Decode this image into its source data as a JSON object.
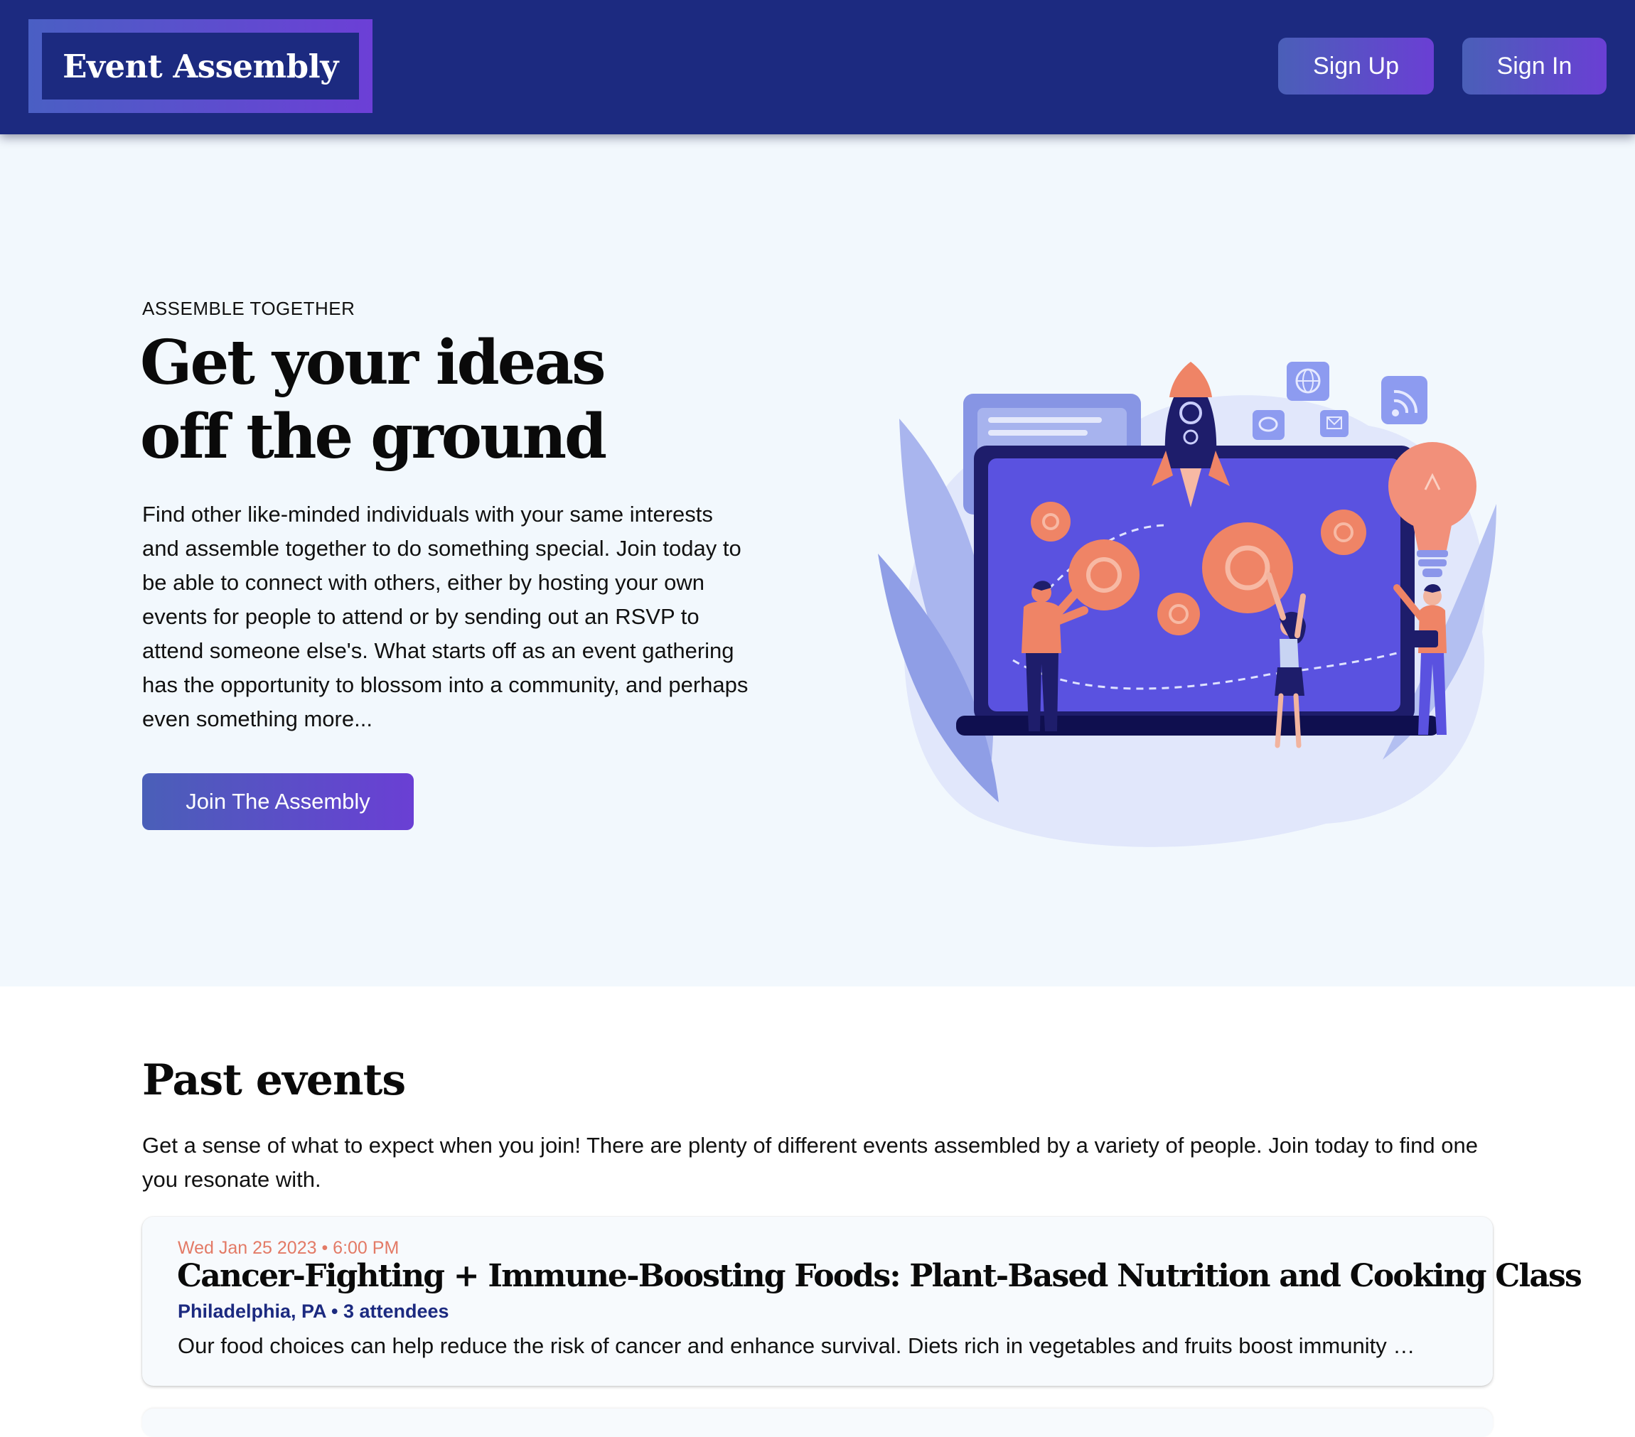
{
  "header": {
    "logo_text": "Event Assembly",
    "signup_label": "Sign Up",
    "signin_label": "Sign In"
  },
  "hero": {
    "eyebrow": "ASSEMBLE TOGETHER",
    "title_line1": "Get your ideas",
    "title_line2": "off the ground",
    "description": "Find other like-minded individuals with your same interests and assemble together to do something special. Join today to be able to connect with others, either by hosting your own events for people to attend or by sending out an RSVP to attend someone else's. What starts off as an event gathering has the opportunity to blossom into a community, and perhaps even something more...",
    "cta_label": "Join The Assembly",
    "illustration": "rocket-laptop-gears-illustration"
  },
  "past_events": {
    "title": "Past events",
    "description": "Get a sense of what to expect when you join! There are plenty of different events assembled by a variety of people. Join today to find one you resonate with.",
    "events": [
      {
        "date": "Wed Jan 25 2023 • 6:00 PM",
        "title": "Cancer-Fighting + Immune-Boosting Foods: Plant-Based Nutrition and Cooking Class",
        "meta": "Philadelphia, PA • 3 attendees",
        "summary": "Our food choices can help reduce the risk of cancer and enhance survival. Diets rich in vegetables and fruits boost immunity …"
      }
    ]
  },
  "colors": {
    "header_bg": "#1c2a80",
    "hero_bg": "#f2f8fd",
    "gradient_start": "#4a5fb8",
    "gradient_end": "#6a3fd4",
    "date_accent": "#e37a66",
    "illustration_orange": "#ef8466",
    "illustration_violet": "#5a52e0"
  }
}
